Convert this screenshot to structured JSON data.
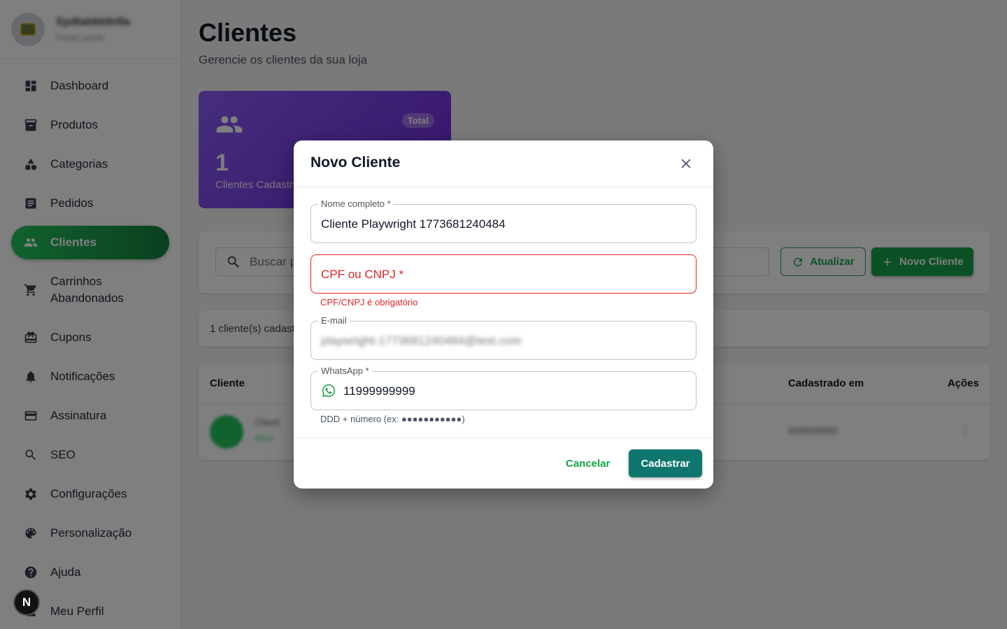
{
  "sidebar": {
    "store_name": "Sydtatdddnlla",
    "store_sub": "Painel admin",
    "items": [
      {
        "label": "Dashboard",
        "icon": "dashboard-icon"
      },
      {
        "label": "Produtos",
        "icon": "archive-icon"
      },
      {
        "label": "Categorias",
        "icon": "category-icon"
      },
      {
        "label": "Pedidos",
        "icon": "list-icon"
      },
      {
        "label": "Clientes",
        "icon": "people-icon",
        "active": true
      },
      {
        "label": "Carrinhos Abandonados",
        "icon": "cart-icon"
      },
      {
        "label": "Cupons",
        "icon": "coupon-icon"
      },
      {
        "label": "Notificações",
        "icon": "bell-icon"
      },
      {
        "label": "Assinatura",
        "icon": "card-icon"
      },
      {
        "label": "SEO",
        "icon": "search-icon"
      },
      {
        "label": "Configurações",
        "icon": "gear-icon"
      },
      {
        "label": "Personalização",
        "icon": "palette-icon"
      },
      {
        "label": "Ajuda",
        "icon": "help-icon"
      },
      {
        "label": "Meu Perfil",
        "icon": "person-icon"
      }
    ]
  },
  "dev_badge": "N",
  "page": {
    "title": "Clientes",
    "subtitle": "Gerencie os clientes da sua loja"
  },
  "stat": {
    "badge": "Total",
    "value": "1",
    "caption": "Clientes Cadastrados"
  },
  "toolbar": {
    "search_placeholder": "Buscar por nome, CPF/CNPJ ou e-mail",
    "refresh_label": "Atualizar",
    "new_label": "Novo Cliente"
  },
  "count_text": "1 cliente(s) cadastrado(s)",
  "table": {
    "columns": [
      "Cliente",
      "Cadastrado em",
      "Ações"
    ],
    "row": {
      "name": "Client",
      "sub": "Ativo",
      "date": "00/00/0000",
      "action": "⋮"
    }
  },
  "dialog": {
    "title": "Novo Cliente",
    "name_label": "Nome completo *",
    "name_value": "Cliente Playwright 1773681240484",
    "doc_placeholder": "CPF ou CNPJ *",
    "doc_error": "CPF/CNPJ é obrigatório",
    "email_label": "E-mail",
    "email_value": "playwright-1773681240484@test.com",
    "whatsapp_label": "WhatsApp *",
    "whatsapp_value": "11999999999",
    "whatsapp_helper": "DDD + número (ex: ●●●●●●●●●●●)",
    "cancel_label": "Cancelar",
    "submit_label": "Cadastrar"
  },
  "colors": {
    "accent": "#16a34a",
    "primary_dark": "#0f766e",
    "stat_card": "#7c3aed",
    "error": "#dc2626"
  }
}
